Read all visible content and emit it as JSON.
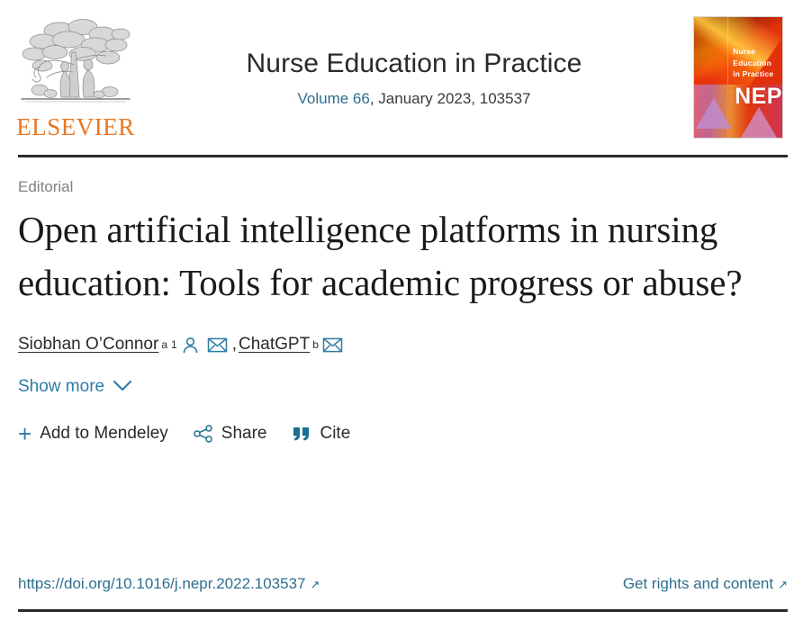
{
  "masthead": {
    "publisher_logo": {
      "wordmark": "ELSEVIER",
      "icon_name": "elsevier-tree-logo"
    },
    "journal_title": "Nurse Education in Practice",
    "volume_link": "Volume 66",
    "issue_meta": ", January 2023, 103537",
    "cover": {
      "title_lines": "Nurse Education in Practice",
      "acronym": "NEP"
    }
  },
  "article": {
    "type_label": "Editorial",
    "title": "Open artificial intelligence platforms in nursing education: Tools for academic progress or abuse?",
    "authors": [
      {
        "name": "Siobhan O’Connor",
        "affiliation_marks": [
          "a",
          "1"
        ],
        "has_profile_icon": true,
        "has_email_icon": true
      },
      {
        "name": "ChatGPT",
        "affiliation_marks": [
          "b"
        ],
        "has_profile_icon": false,
        "has_email_icon": true
      }
    ],
    "author_separator": ",",
    "show_more_label": "Show more"
  },
  "actions": [
    {
      "label": "Add to Mendeley",
      "icon": "plus-icon"
    },
    {
      "label": "Share",
      "icon": "share-icon"
    },
    {
      "label": "Cite",
      "icon": "quote-icon"
    }
  ],
  "footer": {
    "doi_url": "https://doi.org/10.1016/j.nepr.2022.103537",
    "rights_label": "Get rights and content",
    "external_arrow": "↗"
  },
  "colors": {
    "link": "#2e6e8e",
    "accent_icon": "#2e7ba6",
    "elsevier_orange": "#e87722",
    "rule": "#2b2b2b",
    "muted_text": "#808080",
    "cover_red": "#e03a10"
  }
}
